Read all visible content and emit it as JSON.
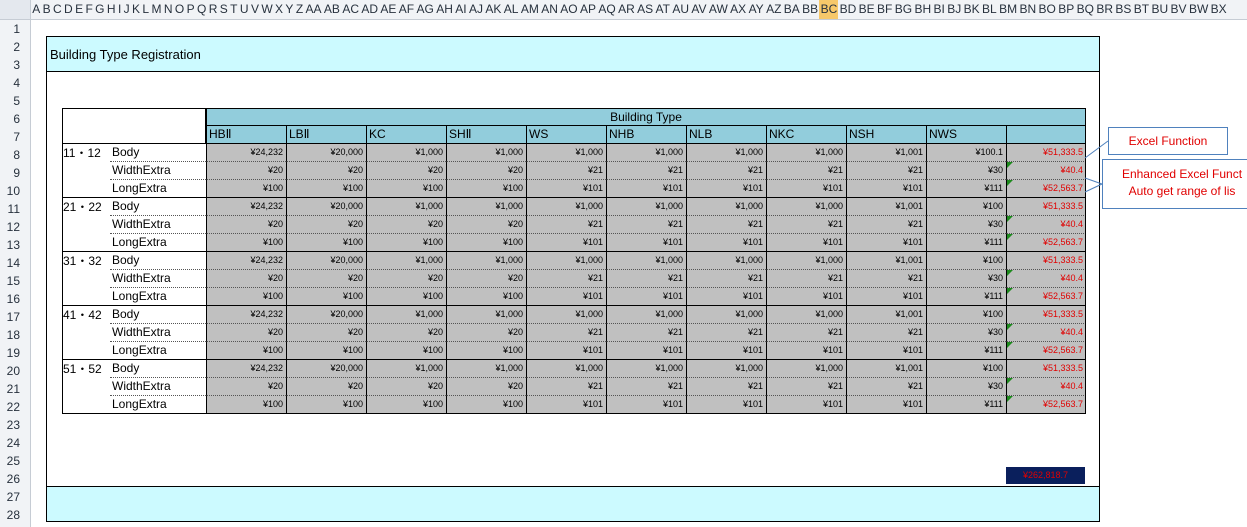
{
  "column_headers": [
    "A",
    "B",
    "C",
    "D",
    "E",
    "F",
    "G",
    "H",
    "I",
    "J",
    "K",
    "L",
    "M",
    "N",
    "O",
    "P",
    "Q",
    "R",
    "S",
    "T",
    "U",
    "V",
    "W",
    "X",
    "Y",
    "Z",
    "AA",
    "AB",
    "AC",
    "AD",
    "AE",
    "AF",
    "AG",
    "AH",
    "AI",
    "AJ",
    "AK",
    "AL",
    "AM",
    "AN",
    "AO",
    "AP",
    "AQ",
    "AR",
    "AS",
    "AT",
    "AU",
    "AV",
    "AW",
    "AX",
    "AY",
    "AZ",
    "BA",
    "BB",
    "BC",
    "BD",
    "BE",
    "BF",
    "BG",
    "BH",
    "BI",
    "BJ",
    "BK",
    "BL",
    "BM",
    "BN",
    "BO",
    "BP",
    "BQ",
    "BR",
    "BS",
    "BT",
    "BU",
    "BV",
    "BW",
    "BX"
  ],
  "selected_column": "BC",
  "row_headers": [
    "1",
    "2",
    "3",
    "4",
    "5",
    "6",
    "7",
    "8",
    "9",
    "10",
    "11",
    "12",
    "13",
    "14",
    "15",
    "16",
    "17",
    "18",
    "19",
    "20",
    "21",
    "22",
    "23",
    "24",
    "25",
    "26",
    "27",
    "28"
  ],
  "title": "Building Type Registration",
  "table": {
    "group_header": "Building Type",
    "columns": [
      "HBⅡ",
      "LBⅡ",
      "KC",
      "SHⅡ",
      "WS",
      "NHB",
      "NLB",
      "NKC",
      "NSH",
      "NWS",
      ""
    ],
    "row_labels": [
      "Body",
      "WidthExtra",
      "LongExtra"
    ],
    "groups": [
      {
        "label": "11・12",
        "rows": [
          [
            "¥24,232",
            "¥20,000",
            "¥1,000",
            "¥1,000",
            "¥1,000",
            "¥1,000",
            "¥1,000",
            "¥1,000",
            "¥1,001",
            "¥100.1",
            "¥51,333.5"
          ],
          [
            "¥20",
            "¥20",
            "¥20",
            "¥20",
            "¥21",
            "¥21",
            "¥21",
            "¥21",
            "¥21",
            "¥30",
            "¥40.4"
          ],
          [
            "¥100",
            "¥100",
            "¥100",
            "¥100",
            "¥101",
            "¥101",
            "¥101",
            "¥101",
            "¥101",
            "¥111",
            "¥52,563.7"
          ]
        ]
      },
      {
        "label": "21・22",
        "rows": [
          [
            "¥24,232",
            "¥20,000",
            "¥1,000",
            "¥1,000",
            "¥1,000",
            "¥1,000",
            "¥1,000",
            "¥1,000",
            "¥1,001",
            "¥100",
            "¥51,333.5"
          ],
          [
            "¥20",
            "¥20",
            "¥20",
            "¥20",
            "¥21",
            "¥21",
            "¥21",
            "¥21",
            "¥21",
            "¥30",
            "¥40.4"
          ],
          [
            "¥100",
            "¥100",
            "¥100",
            "¥100",
            "¥101",
            "¥101",
            "¥101",
            "¥101",
            "¥101",
            "¥111",
            "¥52,563.7"
          ]
        ]
      },
      {
        "label": "31・32",
        "rows": [
          [
            "¥24,232",
            "¥20,000",
            "¥1,000",
            "¥1,000",
            "¥1,000",
            "¥1,000",
            "¥1,000",
            "¥1,000",
            "¥1,001",
            "¥100",
            "¥51,333.5"
          ],
          [
            "¥20",
            "¥20",
            "¥20",
            "¥20",
            "¥21",
            "¥21",
            "¥21",
            "¥21",
            "¥21",
            "¥30",
            "¥40.4"
          ],
          [
            "¥100",
            "¥100",
            "¥100",
            "¥100",
            "¥101",
            "¥101",
            "¥101",
            "¥101",
            "¥101",
            "¥111",
            "¥52,563.7"
          ]
        ]
      },
      {
        "label": "41・42",
        "rows": [
          [
            "¥24,232",
            "¥20,000",
            "¥1,000",
            "¥1,000",
            "¥1,000",
            "¥1,000",
            "¥1,000",
            "¥1,000",
            "¥1,001",
            "¥100",
            "¥51,333.5"
          ],
          [
            "¥20",
            "¥20",
            "¥20",
            "¥20",
            "¥21",
            "¥21",
            "¥21",
            "¥21",
            "¥21",
            "¥30",
            "¥40.4"
          ],
          [
            "¥100",
            "¥100",
            "¥100",
            "¥100",
            "¥101",
            "¥101",
            "¥101",
            "¥101",
            "¥101",
            "¥111",
            "¥52,563.7"
          ]
        ]
      },
      {
        "label": "51・52",
        "rows": [
          [
            "¥24,232",
            "¥20,000",
            "¥1,000",
            "¥1,000",
            "¥1,000",
            "¥1,000",
            "¥1,000",
            "¥1,000",
            "¥1,001",
            "¥100",
            "¥51,333.5"
          ],
          [
            "¥20",
            "¥20",
            "¥20",
            "¥20",
            "¥21",
            "¥21",
            "¥21",
            "¥21",
            "¥21",
            "¥30",
            "¥40.4"
          ],
          [
            "¥100",
            "¥100",
            "¥100",
            "¥100",
            "¥101",
            "¥101",
            "¥101",
            "¥101",
            "¥101",
            "¥111",
            "¥52,563.7"
          ]
        ]
      }
    ]
  },
  "grand_total": "¥262,818.7",
  "notes": {
    "excel_function": "Excel Function",
    "enhanced_line1": "Enhanced Excel Funct",
    "enhanced_line2": "Auto get range of lis"
  },
  "colors": {
    "band": "#ccfaff",
    "header": "#92cddc",
    "value_cell": "#c0c0c0",
    "total_text": "#e00000",
    "grand_total_bg": "#0a1f5c",
    "selected_column": "#f7c86a"
  }
}
